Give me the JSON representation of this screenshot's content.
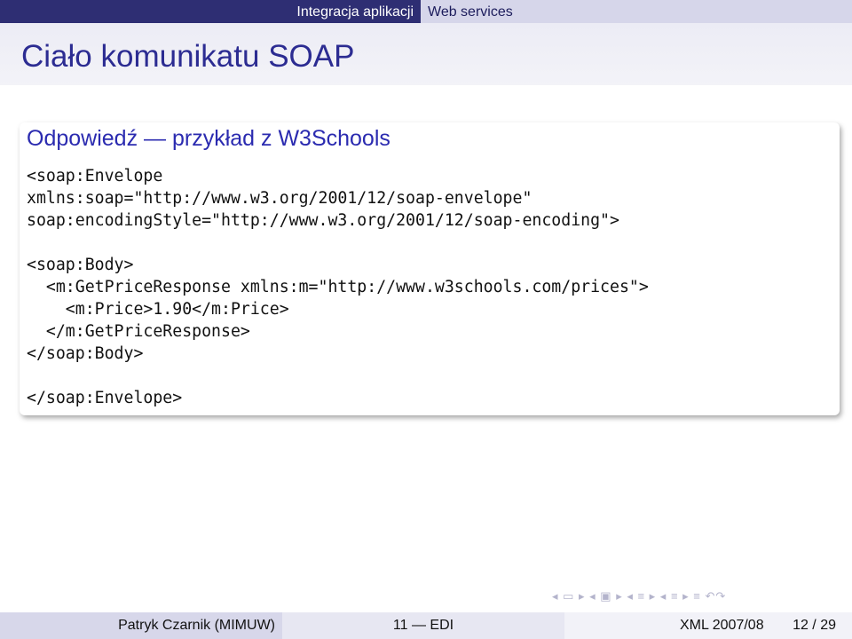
{
  "header": {
    "section_left": "Integracja aplikacji",
    "section_right": "Web services"
  },
  "slide": {
    "title": "Ciało komunikatu SOAP",
    "block_title": "Odpowiedź — przykład z W3Schools",
    "code_lines": [
      "<soap:Envelope",
      "xmlns:soap=\"http://www.w3.org/2001/12/soap-envelope\"",
      "soap:encodingStyle=\"http://www.w3.org/2001/12/soap-encoding\">",
      "",
      "<soap:Body>",
      "  <m:GetPriceResponse xmlns:m=\"http://www.w3schools.com/prices\">",
      "    <m:Price>1.90</m:Price>",
      "  </m:GetPriceResponse>",
      "</soap:Body>",
      "",
      "</soap:Envelope>"
    ]
  },
  "nav_symbols": "◂ ▭ ▸ ◂ ▣ ▸ ◂ ≡ ▸ ◂ ≡ ▸  ≡  ↶↷",
  "footer": {
    "author": "Patryk Czarnik (MIMUW)",
    "lecture": "11 — EDI",
    "date": "XML 2007/08",
    "page": "12 / 29"
  }
}
